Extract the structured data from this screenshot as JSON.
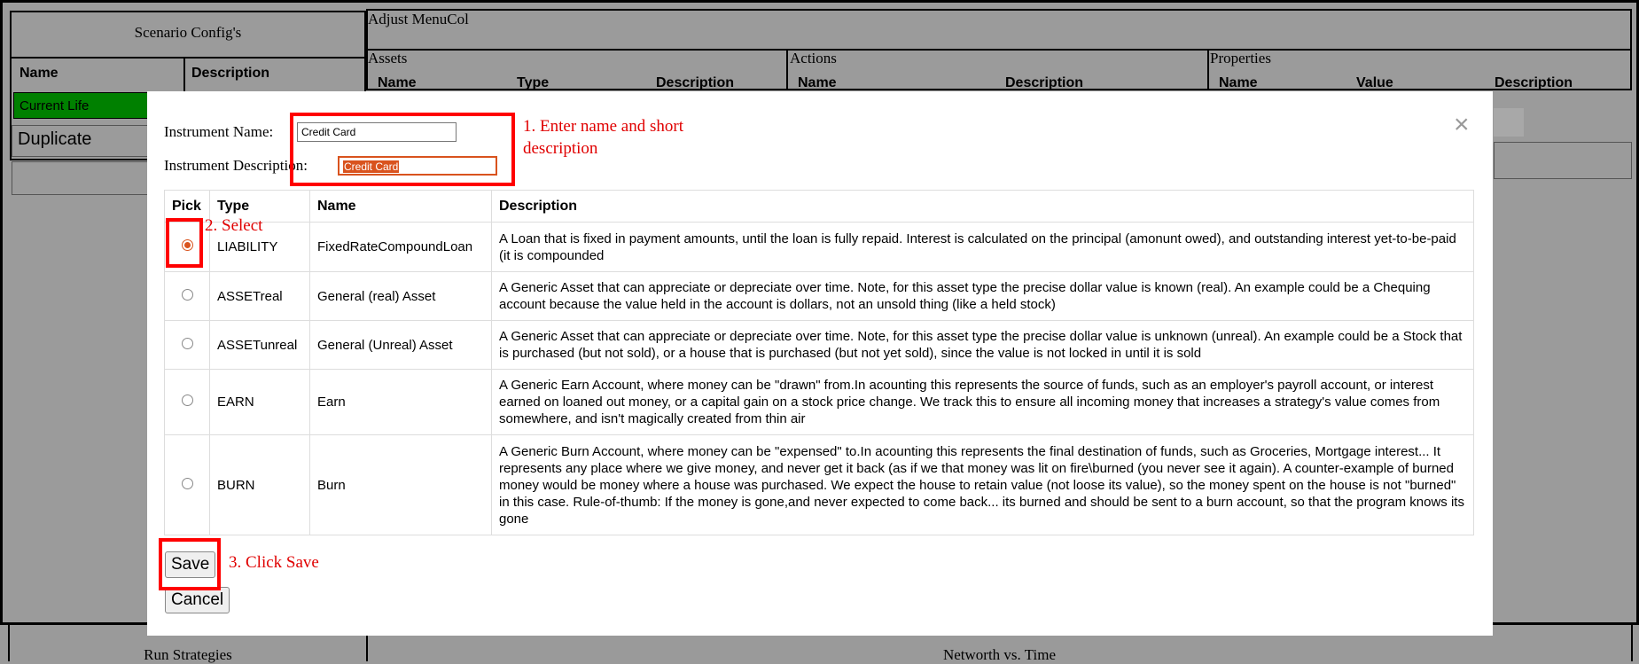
{
  "background": {
    "scenario_title": "Scenario Config's",
    "scenario_cols": [
      "Name",
      "Description"
    ],
    "scenario_row_name": "Current Life",
    "duplicate_label": "Duplicate",
    "adjust_title": "Adjust MenuCol",
    "assets_title": "Assets",
    "assets_cols": [
      "Name",
      "Type",
      "Description"
    ],
    "actions_title": "Actions",
    "actions_cols": [
      "Name",
      "Description"
    ],
    "properties_title": "Properties",
    "properties_cols": [
      "Name",
      "Value",
      "Description"
    ],
    "run_strategies": "Run Strategies",
    "networth_title": "Networth vs. Time"
  },
  "modal": {
    "name_label": "Instrument Name:",
    "name_value": "Credit Card",
    "desc_label": "Instrument Description:",
    "desc_value": "Credit Card",
    "columns": [
      "Pick",
      "Type",
      "Name",
      "Description"
    ],
    "rows": [
      {
        "type": "LIABILITY",
        "name": "FixedRateCompoundLoan",
        "description": "A Loan that is fixed in payment amounts, until the loan is fully repaid. Interest is calculated on the principal (amonunt owed), and outstanding interest yet-to-be-paid (it is compounded",
        "selected": true
      },
      {
        "type": "ASSETreal",
        "name": "General (real) Asset",
        "description": "A Generic Asset that can appreciate or depreciate over time. Note, for this asset type the precise dollar value is known (real). An example could be a Chequing account because the value held in the account is dollars, not an unsold thing (like a held stock)",
        "selected": false
      },
      {
        "type": "ASSETunreal",
        "name": "General (Unreal) Asset",
        "description": "A Generic Asset that can appreciate or depreciate over time. Note, for this asset type the precise dollar value is unknown (unreal). An example could be a Stock that is purchased (but not sold), or a house that is purchased (but not yet sold), since the value is not locked in until it is sold",
        "selected": false
      },
      {
        "type": "EARN",
        "name": "Earn",
        "description": "A Generic Earn Account, where money can be \"drawn\" from.In acounting this represents the source of funds, such as an employer's payroll account, or interest earned on loaned out money, or a capital gain on a stock price change. We track this to ensure all incoming money that increases a strategy's value comes from somewhere, and isn't magically created from thin air",
        "selected": false
      },
      {
        "type": "BURN",
        "name": "Burn",
        "description": "A Generic Burn Account, where money can be \"expensed\" to.In acounting this represents the final destination of funds, such as Groceries, Mortgage interest... It represents any place where we give money, and never get it back (as if we that money was lit on fire\\burned (you never see it again). A counter-example of burned money would be money where a house was purchased. We expect the house to retain value (not loose its value), so the money spent on the house is not \"burned\" in this case. Rule-of-thumb: If the money is gone,and never expected to come back... its burned and should be sent to a burn account, so that the program knows its gone",
        "selected": false
      }
    ],
    "save_label": "Save",
    "cancel_label": "Cancel",
    "close_glyph": "×"
  },
  "annotations": {
    "step1": "1. Enter name and short description",
    "step2": "2. Select",
    "step3": "3. Click Save",
    "color": "#ff0000"
  },
  "colors": {
    "accent": "#d9531e",
    "current_row": "#008000",
    "background": "#9a9a9a"
  }
}
